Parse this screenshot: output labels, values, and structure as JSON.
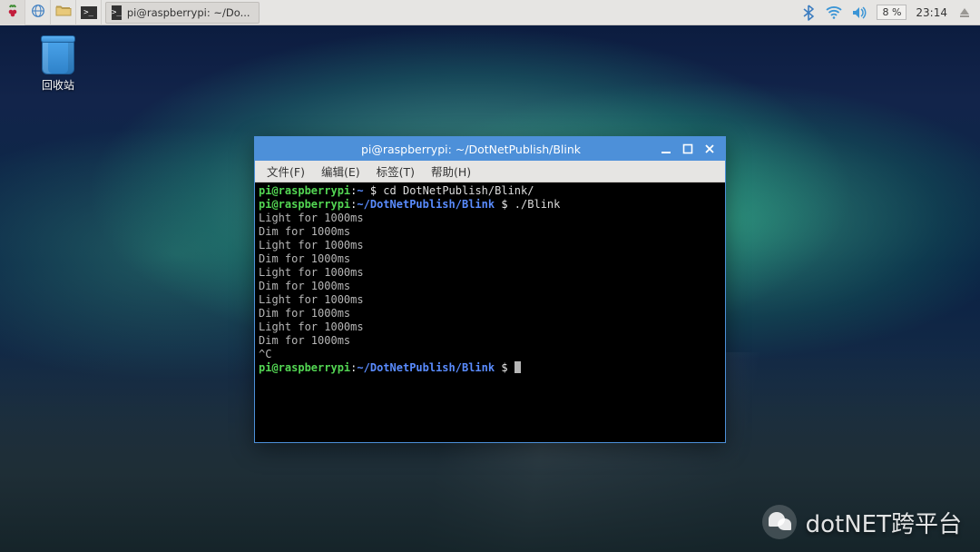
{
  "taskbar": {
    "app_label": "pi@raspberrypi: ~/Do...",
    "battery": "8 %",
    "clock": "23:14"
  },
  "desktop": {
    "trash_label": "回收站"
  },
  "terminal": {
    "title": "pi@raspberrypi: ~/DotNetPublish/Blink",
    "menu": {
      "file": "文件(F)",
      "edit": "编辑(E)",
      "tabs": "标签(T)",
      "help": "帮助(H)"
    },
    "lines": [
      {
        "user": "pi@raspberrypi",
        "sep": ":",
        "path": "~ ",
        "dollar": "$ ",
        "cmd": "cd DotNetPublish/Blink/"
      },
      {
        "user": "pi@raspberrypi",
        "sep": ":",
        "path": "~/DotNetPublish/Blink ",
        "dollar": "$ ",
        "cmd": "./Blink"
      },
      {
        "out": "Light for 1000ms"
      },
      {
        "out": "Dim for 1000ms"
      },
      {
        "out": "Light for 1000ms"
      },
      {
        "out": "Dim for 1000ms"
      },
      {
        "out": "Light for 1000ms"
      },
      {
        "out": "Dim for 1000ms"
      },
      {
        "out": "Light for 1000ms"
      },
      {
        "out": "Dim for 1000ms"
      },
      {
        "out": "Light for 1000ms"
      },
      {
        "out": "Dim for 1000ms"
      },
      {
        "out": "^C"
      },
      {
        "user": "pi@raspberrypi",
        "sep": ":",
        "path": "~/DotNetPublish/Blink ",
        "dollar": "$ ",
        "cursor": true
      }
    ]
  },
  "watermark": {
    "text": "dotNET跨平台"
  }
}
